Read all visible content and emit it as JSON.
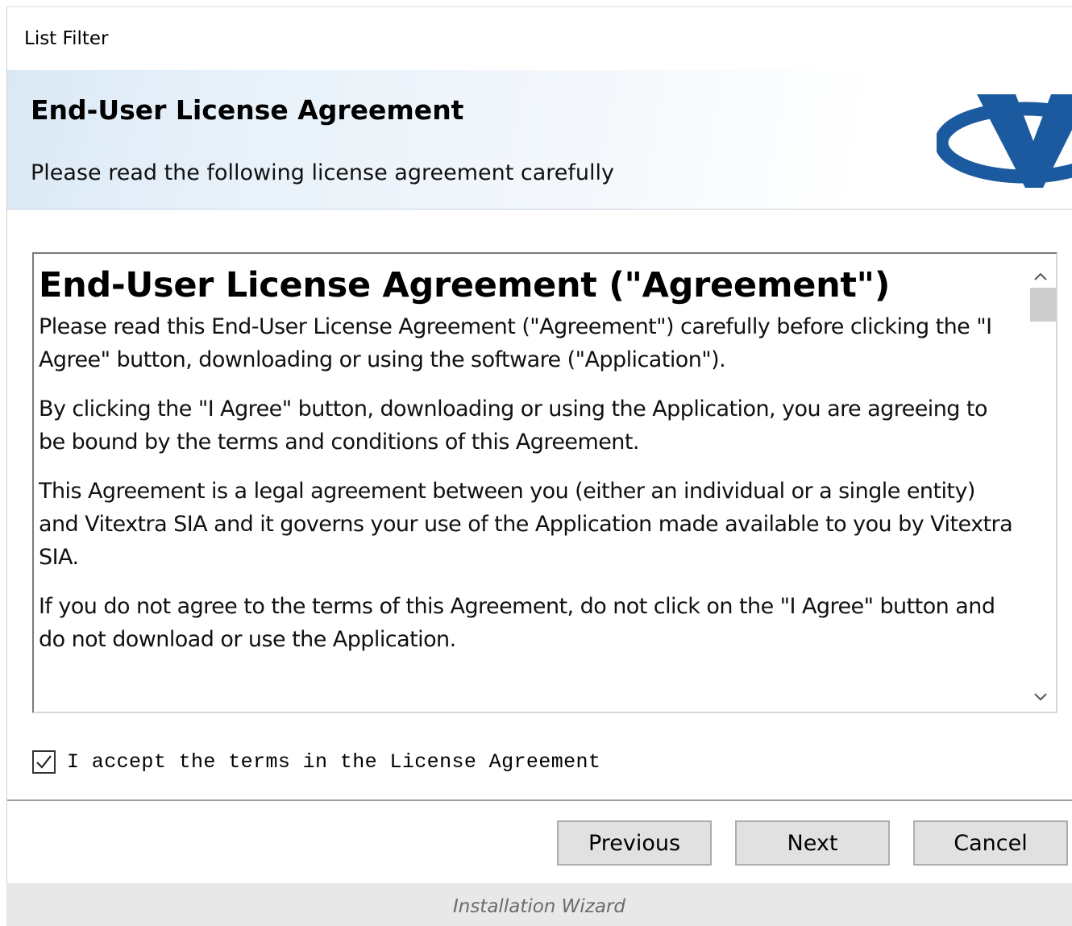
{
  "window": {
    "title": "List Filter"
  },
  "header": {
    "title": "End-User License Agreement",
    "subtitle": "Please read the following license agreement carefully",
    "logo_icon": "vitextra-v-logo-icon",
    "logo_color": "#1b5a9e"
  },
  "license": {
    "heading": "End-User License Agreement (\"Agreement\")",
    "paragraphs": [
      "Please read this End-User License Agreement (\"Agreement\") carefully before clicking the \"I Agree\" button, downloading or using the software (\"Application\").",
      "By clicking the \"I Agree\" button, downloading or using the Application, you are agreeing to be bound by the terms and conditions of this Agreement.",
      "This Agreement is a legal agreement between you (either an individual or a single entity) and Vitextra SIA and it governs your use of the Application made available to you by Vitextra SIA.",
      "If you do not agree to the terms of this Agreement, do not click on the \"I Agree\" button and do not download or use the Application."
    ],
    "scroll_up_icon": "chevron-up-icon",
    "scroll_down_icon": "chevron-down-icon"
  },
  "accept": {
    "checked": true,
    "label": "I accept the terms in the License Agreement"
  },
  "buttons": {
    "previous": "Previous",
    "next": "Next",
    "cancel": "Cancel"
  },
  "caption": "Installation Wizard"
}
